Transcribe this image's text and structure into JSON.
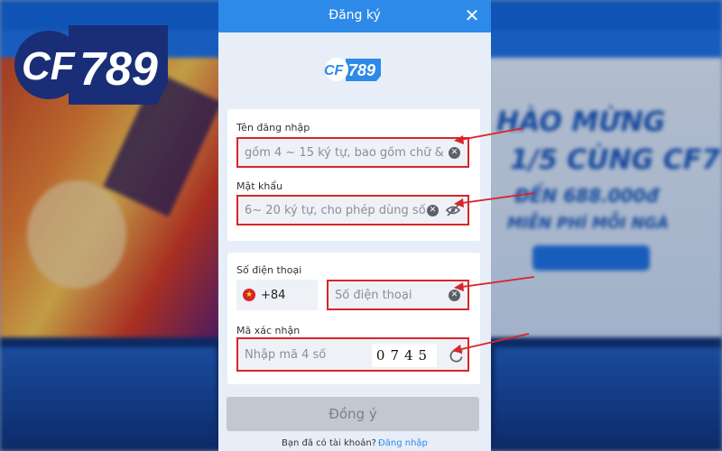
{
  "brand": {
    "logo_text": "CF789",
    "accent": "#2e8ae8",
    "navy": "#1a2e78"
  },
  "modal": {
    "title": "Đăng ký",
    "close_icon": "close-icon",
    "logo_text": "CF789"
  },
  "form": {
    "username": {
      "label": "Tên đăng nhập",
      "placeholder": "gồm 4 ~ 15 ký tự, bao gồm chữ &"
    },
    "password": {
      "label": "Mật khẩu",
      "placeholder": "6~ 20 ký tự, cho phép dùng số"
    },
    "phone": {
      "label": "Số điện thoại",
      "country_code": "+84",
      "placeholder": "Số điện thoại"
    },
    "captcha": {
      "label": "Mã xác nhận",
      "placeholder": "Nhập mã 4 số",
      "code": "0745"
    },
    "submit_label": "Đồng ý"
  },
  "footer": {
    "prompt": "Bạn đã có tài khoản?",
    "login_link": "Đăng nhập"
  },
  "background": {
    "banner_lines": [
      "HÀO MỪNG",
      "1/5 CÙNG CF7",
      "ĐẾN 688.000đ",
      "MIỄN PHÍ MỖI NGÀ"
    ]
  },
  "colors": {
    "highlight": "#d7262a",
    "header": "#2e8ae8",
    "button_disabled": "#c3c8d0"
  }
}
